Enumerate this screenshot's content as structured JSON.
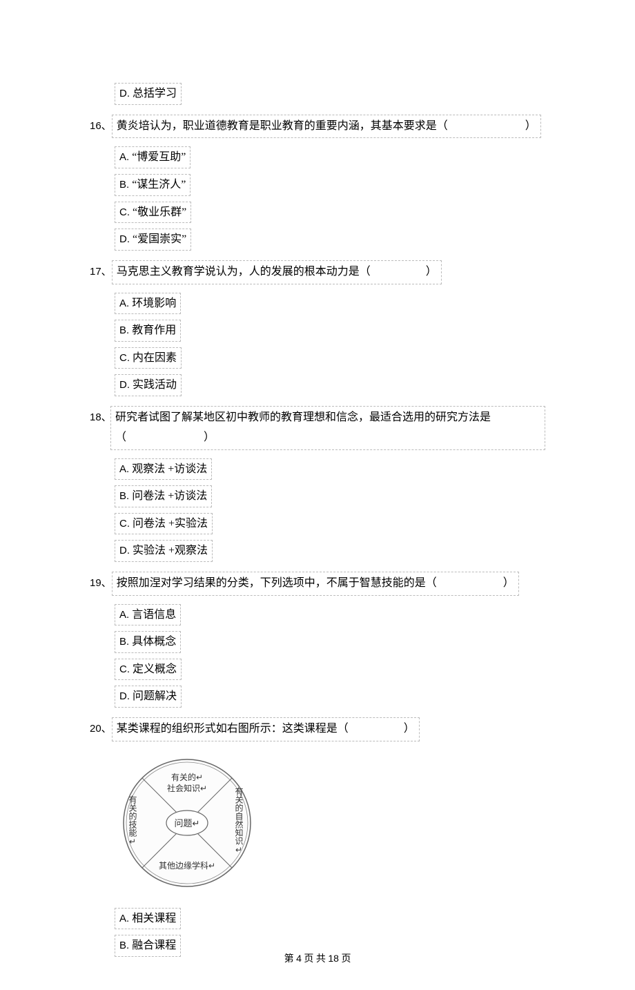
{
  "q15": {
    "D": "总括学习"
  },
  "q16": {
    "num": "16、",
    "text": "黄炎培认为，职业道德教育是职业教育的重要内涵，其基本要求是（　　　　　　　）",
    "A": "“博爱互助”",
    "B": "“谋生济人”",
    "C": "“敬业乐群”",
    "D": "“爱国崇实”"
  },
  "q17": {
    "num": "17、",
    "text": "马克思主义教育学说认为，人的发展的根本动力是（　　　　　）",
    "A": "环境影响",
    "B": "教育作用",
    "C": "内在因素",
    "D": "实践活动"
  },
  "q18": {
    "num": "18、",
    "text": "研究者试图了解某地区初中教师的教育理想和信念，最适合选用的研究方法是（　　　　　　　）",
    "A": "观察法 +访谈法",
    "B": "问卷法 +访谈法",
    "C": "问卷法 +实验法",
    "D": "实验法 +观察法"
  },
  "q19": {
    "num": "19、",
    "text": "按照加涅对学习结果的分类，下列选项中，不属于智慧技能的是（　　　　　　）",
    "A": "言语信息",
    "B": "具体概念",
    "C": "定义概念",
    "D": "问题解决"
  },
  "q20": {
    "num": "20、",
    "text": "某类课程的组织形式如右图所示：这类课程是（　　　　　）",
    "A": "相关课程",
    "B": "融合课程"
  },
  "diagram": {
    "center": "问题↵",
    "top": "有关的↵\n社会知识↵",
    "right": "有关的自然知识↵",
    "left": "有关的技能↵",
    "bottom": "其他边缘学科↵"
  },
  "footer": {
    "prefix": "第 ",
    "page": "4",
    "mid": " 页 共 ",
    "total": "18",
    "suffix": " 页"
  }
}
